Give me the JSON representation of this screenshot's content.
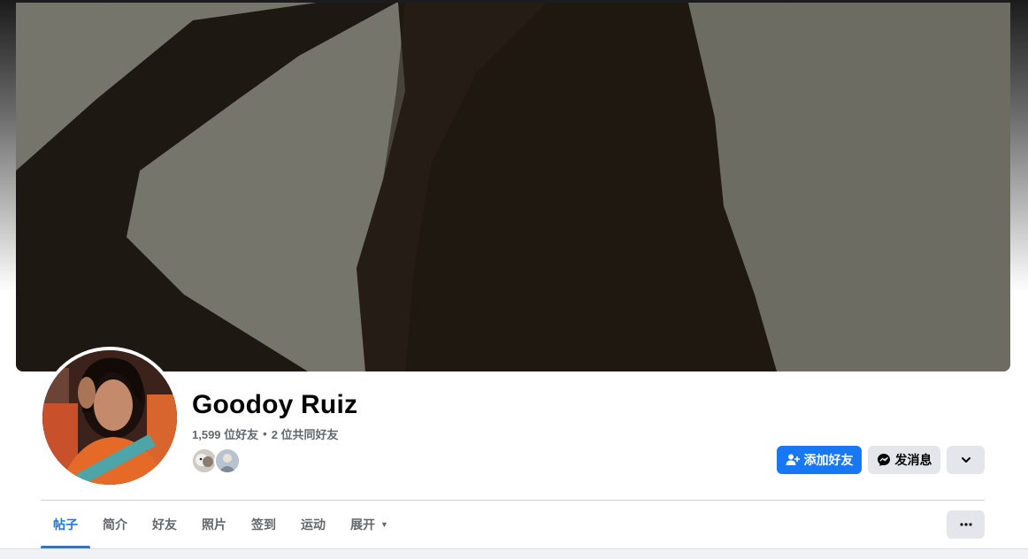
{
  "profile": {
    "name": "Goodoy Ruiz",
    "friends_count": "1,599 位好友",
    "separator": "•",
    "mutual_friends": "2 位共同好友"
  },
  "actions": {
    "add_friend": "添加好友",
    "message": "发消息"
  },
  "tabs": [
    {
      "label": "帖子",
      "active": true
    },
    {
      "label": "简介"
    },
    {
      "label": "好友"
    },
    {
      "label": "照片"
    },
    {
      "label": "签到"
    },
    {
      "label": "运动"
    },
    {
      "label": "展开"
    }
  ],
  "colors": {
    "accent": "#1877f2",
    "secondary_button": "#e4e6eb",
    "muted_text": "#65676b"
  },
  "icons": {
    "add_friend": "add-friend-icon",
    "message": "messenger-icon",
    "chevron": "chevron-down-icon",
    "more": "more-icon",
    "tab_caret": "caret-down-icon"
  }
}
